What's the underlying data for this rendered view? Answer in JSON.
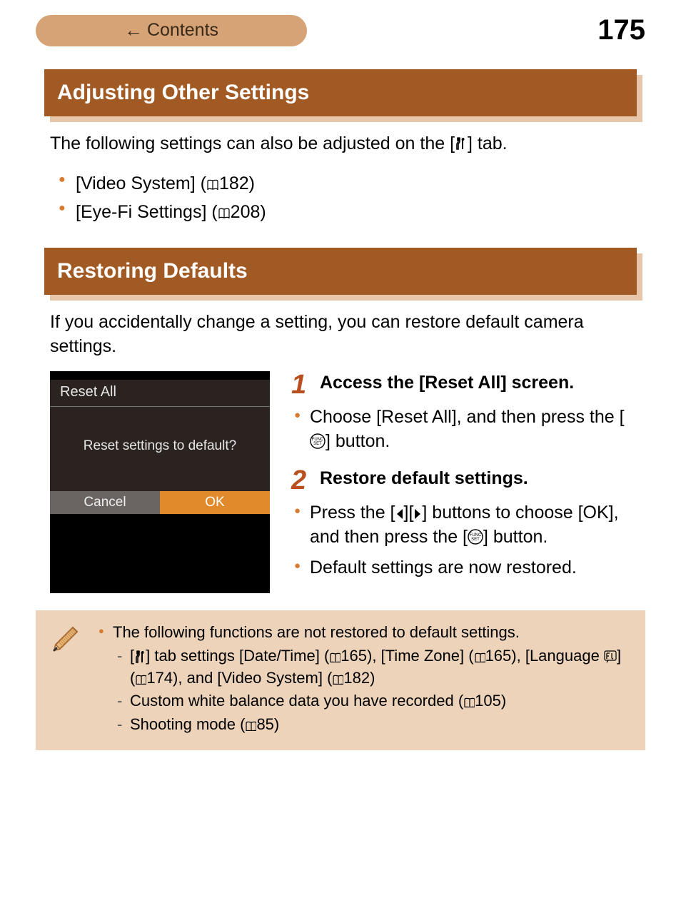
{
  "header": {
    "contents_label": "Contents",
    "page_number": "175"
  },
  "section1": {
    "title": "Adjusting Other Settings",
    "intro_pre": "The following settings can also be adjusted on the [",
    "intro_post": "] tab.",
    "bullets": {
      "b1_pre": "[Video System] (",
      "b1_page": "182",
      "b1_post": ")",
      "b2_pre": "[Eye-Fi Settings] (",
      "b2_page": "208",
      "b2_post": ")"
    }
  },
  "section2": {
    "title": "Restoring Defaults",
    "intro": "If you accidentally change a setting, you can restore default camera settings."
  },
  "screenshot": {
    "title": "Reset All",
    "prompt": "Reset settings to default?",
    "cancel": "Cancel",
    "ok": "OK"
  },
  "steps": {
    "s1_num": "1",
    "s1_title": "Access the [Reset All] screen.",
    "s1_b1_pre": "Choose [Reset All], and then press the [",
    "s1_b1_post": "] button.",
    "s2_num": "2",
    "s2_title": "Restore default settings.",
    "s2_b1_pre": "Press the [",
    "s2_b1_mid": "][",
    "s2_b1_post": "] buttons to choose [OK], and then press the [",
    "s2_b1_end": "] button.",
    "s2_b2": "Default settings are now restored."
  },
  "note": {
    "lead": "The following functions are not restored to default settings.",
    "d1_a": "[",
    "d1_b": "] tab settings [Date/Time] (",
    "d1_p1": "165",
    "d1_c": "), [Time Zone] (",
    "d1_p2": "165",
    "d1_d": "), [Language ",
    "d1_e": "] (",
    "d1_p3": "174",
    "d1_f": "), and [Video System] (",
    "d1_p4": "182",
    "d1_g": ")",
    "d2_a": "Custom white balance data you have recorded (",
    "d2_p": "105",
    "d2_b": ")",
    "d3_a": "Shooting mode (",
    "d3_p": "85",
    "d3_b": ")"
  }
}
